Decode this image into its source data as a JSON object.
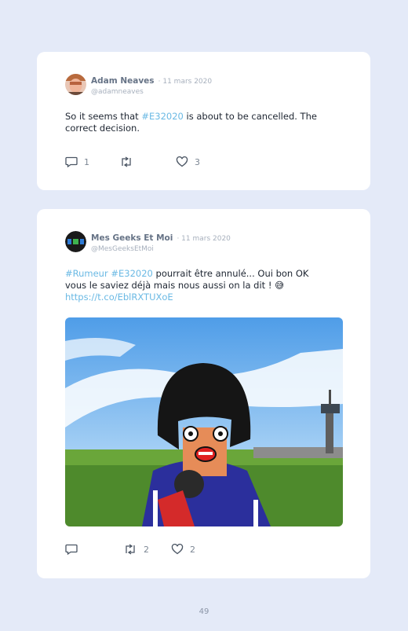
{
  "tweets": [
    {
      "name": "Adam Neaves",
      "date": "· 11 mars 2020",
      "handle": "@adamneaves",
      "text_before": "So it seems that ",
      "hashtag": "#E32020",
      "text_after": " is about to be cancelled. The correct decision.",
      "reply_count": "1",
      "retweet_count": "",
      "like_count": "3"
    },
    {
      "name": "Mes Geeks Et Moi",
      "date": "· 11 mars 2020",
      "handle": "@MesGeeksEtMoi",
      "hashtag1": "#Rumeur",
      "hashtag2": "#E32020",
      "text": " pourrait être annulé... Oui bon OK vous le saviez déjà mais nous aussi on la dit ! ",
      "emoji": "😅",
      "link": "https://t.co/EblRXTUXoE",
      "reply_count": "",
      "retweet_count": "2",
      "like_count": "2"
    }
  ],
  "page_number": "49",
  "colors": {
    "background": "#e4eaf8",
    "link": "#6ab9e4",
    "muted": "#a7b0bd"
  },
  "icons": [
    "reply-icon",
    "retweet-icon",
    "like-icon"
  ]
}
